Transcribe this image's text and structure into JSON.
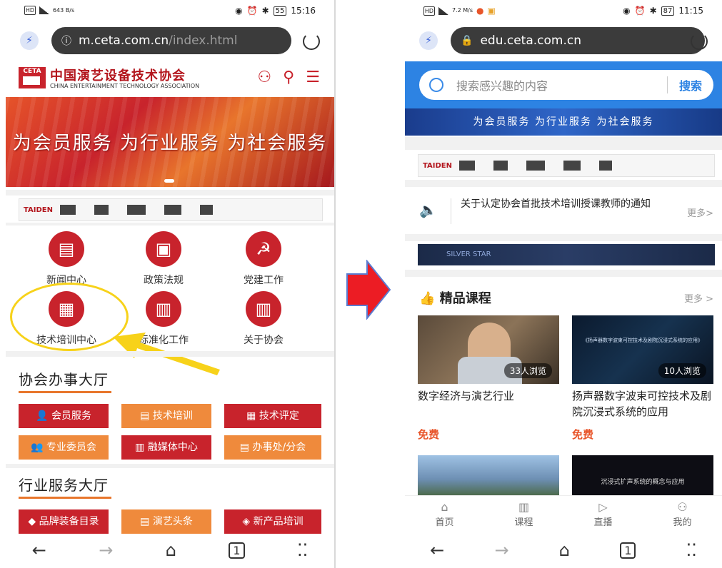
{
  "left": {
    "status": {
      "time": "15:16",
      "battery": "55",
      "net": "643 B/s"
    },
    "address": {
      "host": "m.ceta.com.cn",
      "path": "/index.html"
    },
    "brand": {
      "cn": "中国演艺设备技术协会",
      "en": "CHINA ENTERTAINMENT TECHNOLOGY ASSOCIATION",
      "logo": "CETA"
    },
    "banner": "为会员服务  为行业服务  为社会服务",
    "ad": {
      "brand": "TAIDEN"
    },
    "icons": [
      {
        "label": "新闻中心",
        "icon": "news-icon",
        "glyph": "▤"
      },
      {
        "label": "政策法规",
        "icon": "policy-icon",
        "glyph": "▣"
      },
      {
        "label": "党建工作",
        "icon": "party-icon",
        "glyph": "☭"
      },
      {
        "label": "技术培训中心",
        "icon": "training-icon",
        "glyph": "▦"
      },
      {
        "label": "标准化工作",
        "icon": "standard-icon",
        "glyph": "▥"
      },
      {
        "label": "关于协会",
        "icon": "about-icon",
        "glyph": "▥"
      }
    ],
    "hall1": {
      "title": "协会办事大厅",
      "buttons": [
        "会员服务",
        "技术培训",
        "技术评定",
        "专业委员会",
        "融媒体中心",
        "办事处/分会"
      ]
    },
    "hall2": {
      "title": "行业服务大厅",
      "buttons": [
        "品牌装备目录",
        "演艺头条",
        "新产品培训"
      ]
    }
  },
  "right": {
    "status": {
      "time": "11:15",
      "battery": "87",
      "net": "7.2 M/s"
    },
    "address": {
      "host": "edu.ceta.com.cn"
    },
    "search": {
      "placeholder": "搜索感兴趣的内容",
      "button": "搜索"
    },
    "banner": "为会员服务  为行业服务  为社会服务",
    "ad": {
      "brand": "TAIDEN"
    },
    "notice": {
      "text": "关于认定协会首批技术培训授课教师的通知",
      "more": "更多>"
    },
    "courses": {
      "title": "精品课程",
      "more": "更多 >",
      "items": [
        {
          "title": "数字经济与演艺行业",
          "views": "33人浏览",
          "price": "免费"
        },
        {
          "title": "扬声器数字波束可控技术及剧院沉浸式系统的应用",
          "views": "10人浏览",
          "price": "免费",
          "thumb_text": "《扬声器数字波束可控技术及剧院沉浸式系统的应用》"
        }
      ],
      "next_thumb_text": "沉浸式扩声系统的概念与应用"
    },
    "tabs": [
      "首页",
      "课程",
      "直播",
      "我的"
    ]
  },
  "colors": {
    "brand_red": "#c8232c",
    "orange": "#ef8a3c",
    "blue": "#2d83e3",
    "highlight": "#f7d21a"
  }
}
